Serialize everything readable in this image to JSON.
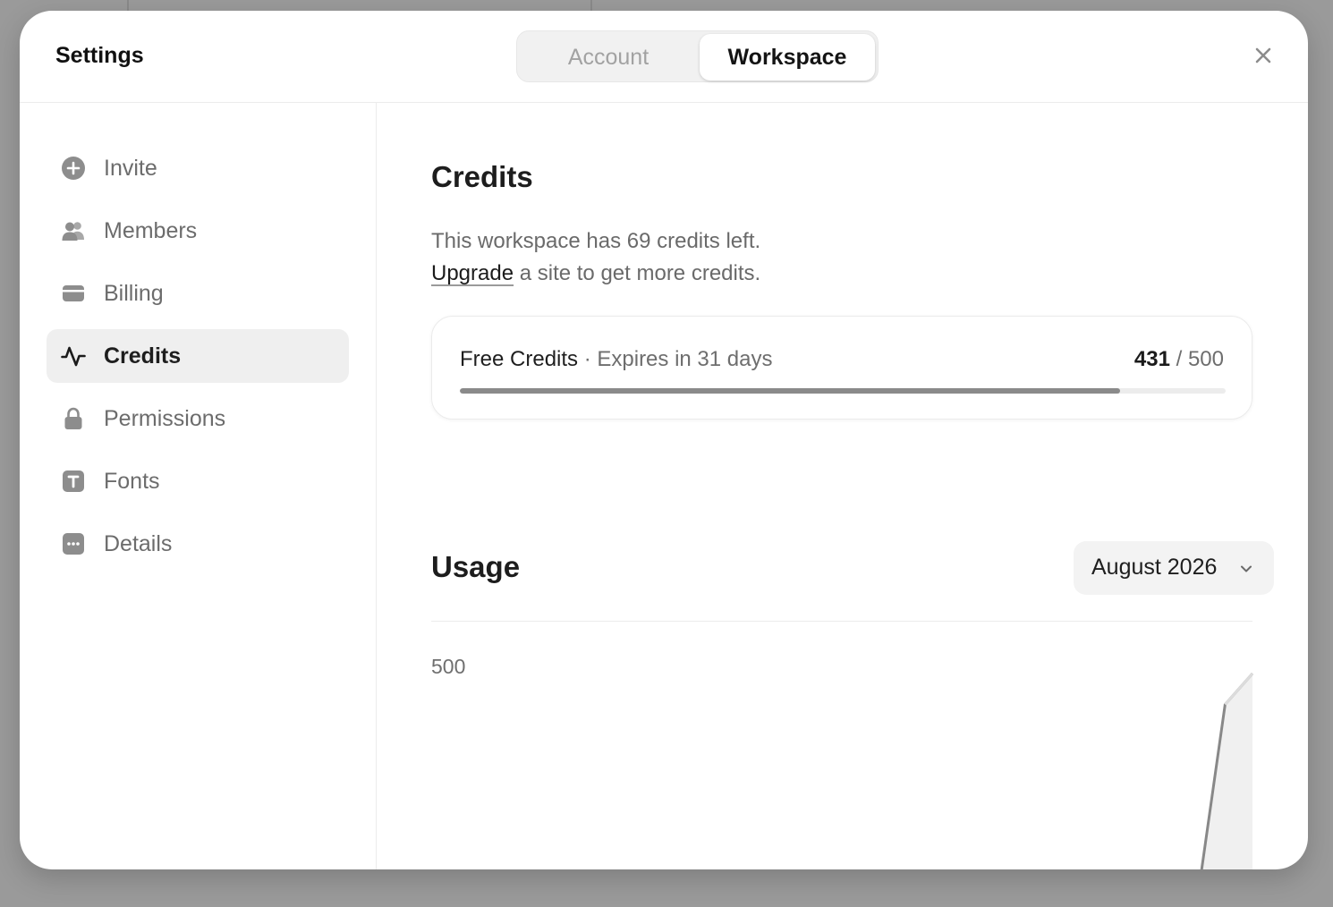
{
  "header": {
    "title": "Settings",
    "tabs": [
      {
        "label": "Account",
        "active": false
      },
      {
        "label": "Workspace",
        "active": true
      }
    ],
    "close_icon": "close-icon"
  },
  "sidebar": {
    "items": [
      {
        "label": "Invite",
        "icon": "plus-circle-icon",
        "active": false
      },
      {
        "label": "Members",
        "icon": "users-icon",
        "active": false
      },
      {
        "label": "Billing",
        "icon": "credit-card-icon",
        "active": false
      },
      {
        "label": "Credits",
        "icon": "activity-icon",
        "active": true
      },
      {
        "label": "Permissions",
        "icon": "lock-icon",
        "active": false
      },
      {
        "label": "Fonts",
        "icon": "text-icon",
        "active": false
      },
      {
        "label": "Details",
        "icon": "more-icon",
        "active": false
      }
    ]
  },
  "credits": {
    "heading": "Credits",
    "line1": "This workspace has 69 credits left.",
    "upgrade_link": "Upgrade",
    "line2_rest": " a site to get more credits.",
    "card": {
      "name": "Free Credits",
      "expiry": " · Expires in 31 days",
      "used": "431",
      "total": " / 500",
      "progress_fraction": 0.862
    }
  },
  "usage": {
    "heading": "Usage",
    "month": "August 2026"
  },
  "chart_data": {
    "type": "area",
    "yticks": [
      "500"
    ],
    "ylim": [
      0,
      500
    ],
    "series": [
      {
        "values": [
          0,
          0,
          0,
          0,
          0,
          0,
          0,
          0,
          0,
          0,
          0,
          0,
          0,
          0,
          0,
          0,
          0,
          0,
          0,
          0,
          0,
          0,
          0,
          0,
          0,
          0,
          0,
          0,
          0,
          431,
          500
        ]
      }
    ],
    "colors": {
      "line": "#888888",
      "fill": "#f0f0f0"
    }
  }
}
